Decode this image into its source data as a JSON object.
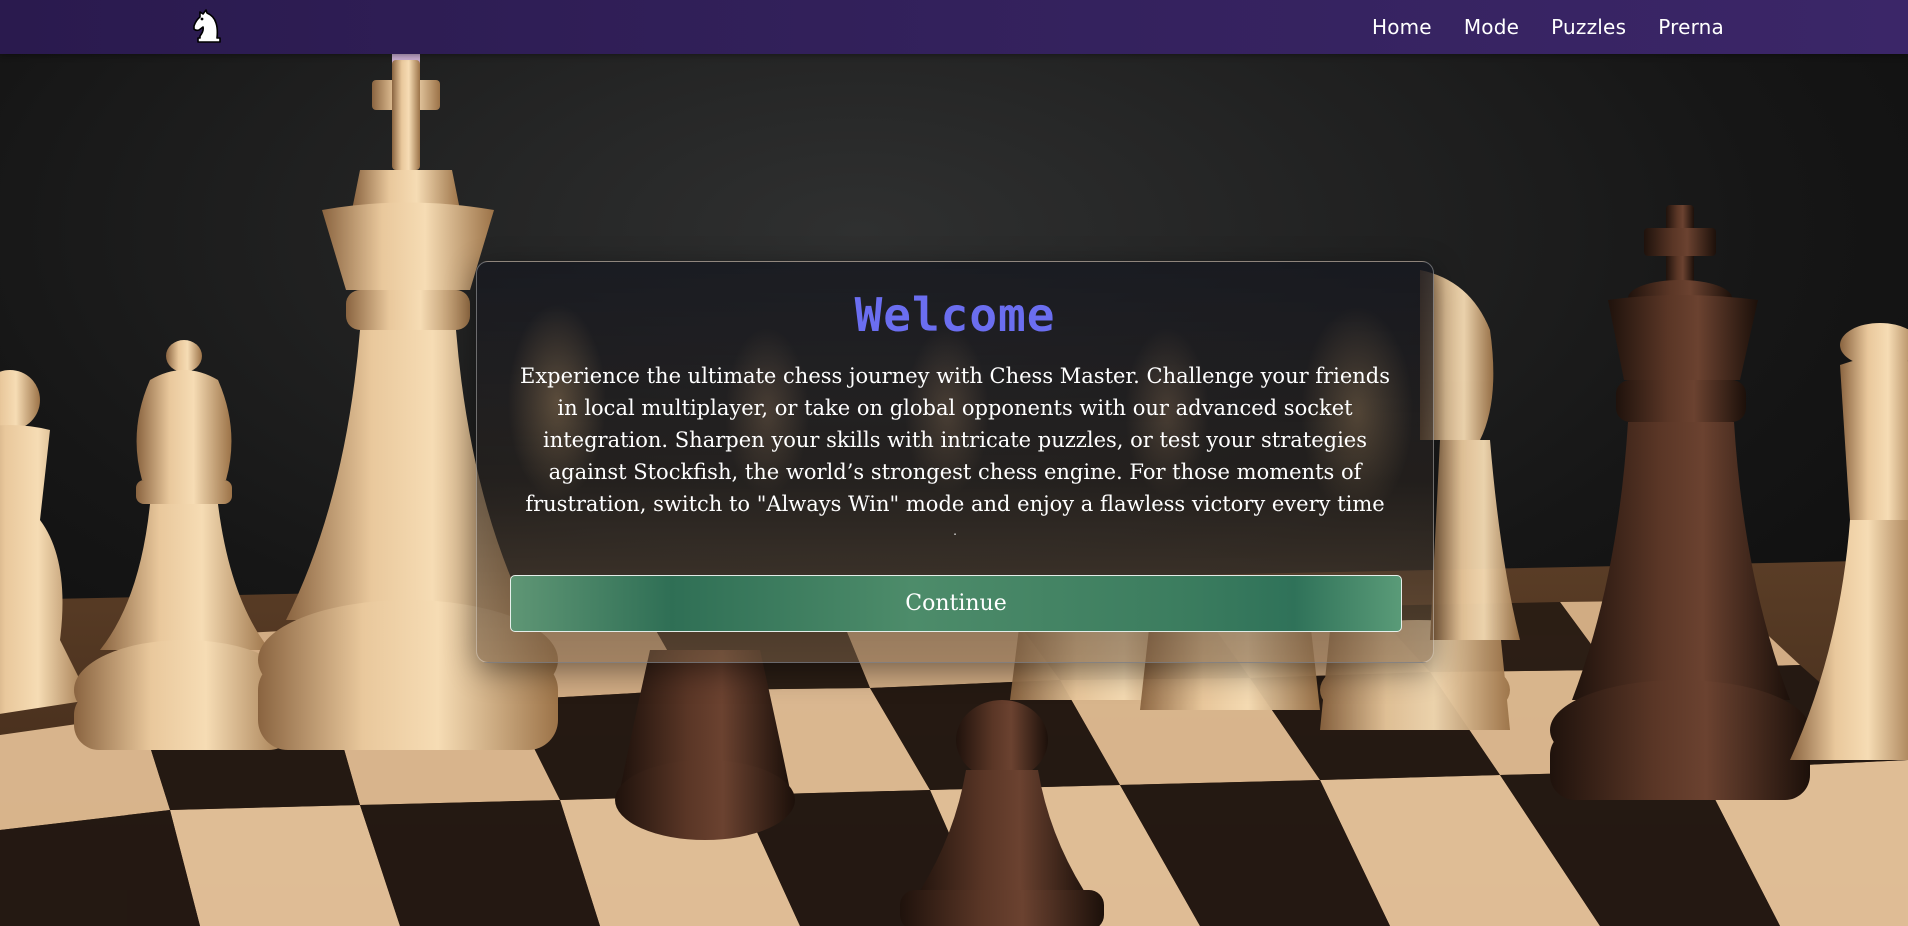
{
  "navbar": {
    "logo_icon": "chess-knight-icon",
    "links": [
      {
        "label": "Home"
      },
      {
        "label": "Mode"
      },
      {
        "label": "Puzzles"
      },
      {
        "label": "Prerna"
      }
    ]
  },
  "welcome": {
    "title": "Welcome",
    "description": "Experience the ultimate chess journey with Chess Master. Challenge your friends in local multiplayer, or take on global opponents with our advanced socket integration. Sharpen your skills with intricate puzzles, or test your strategies against Stockfish, the world’s strongest chess engine. For those moments of frustration, switch to \"Always Win\" mode and enjoy a flawless victory every time",
    "trailing_text": ".",
    "continue_label": "Continue"
  },
  "colors": {
    "navbar": "#33215c",
    "title": "#6b6ef0",
    "button": "#3c7d5f"
  }
}
